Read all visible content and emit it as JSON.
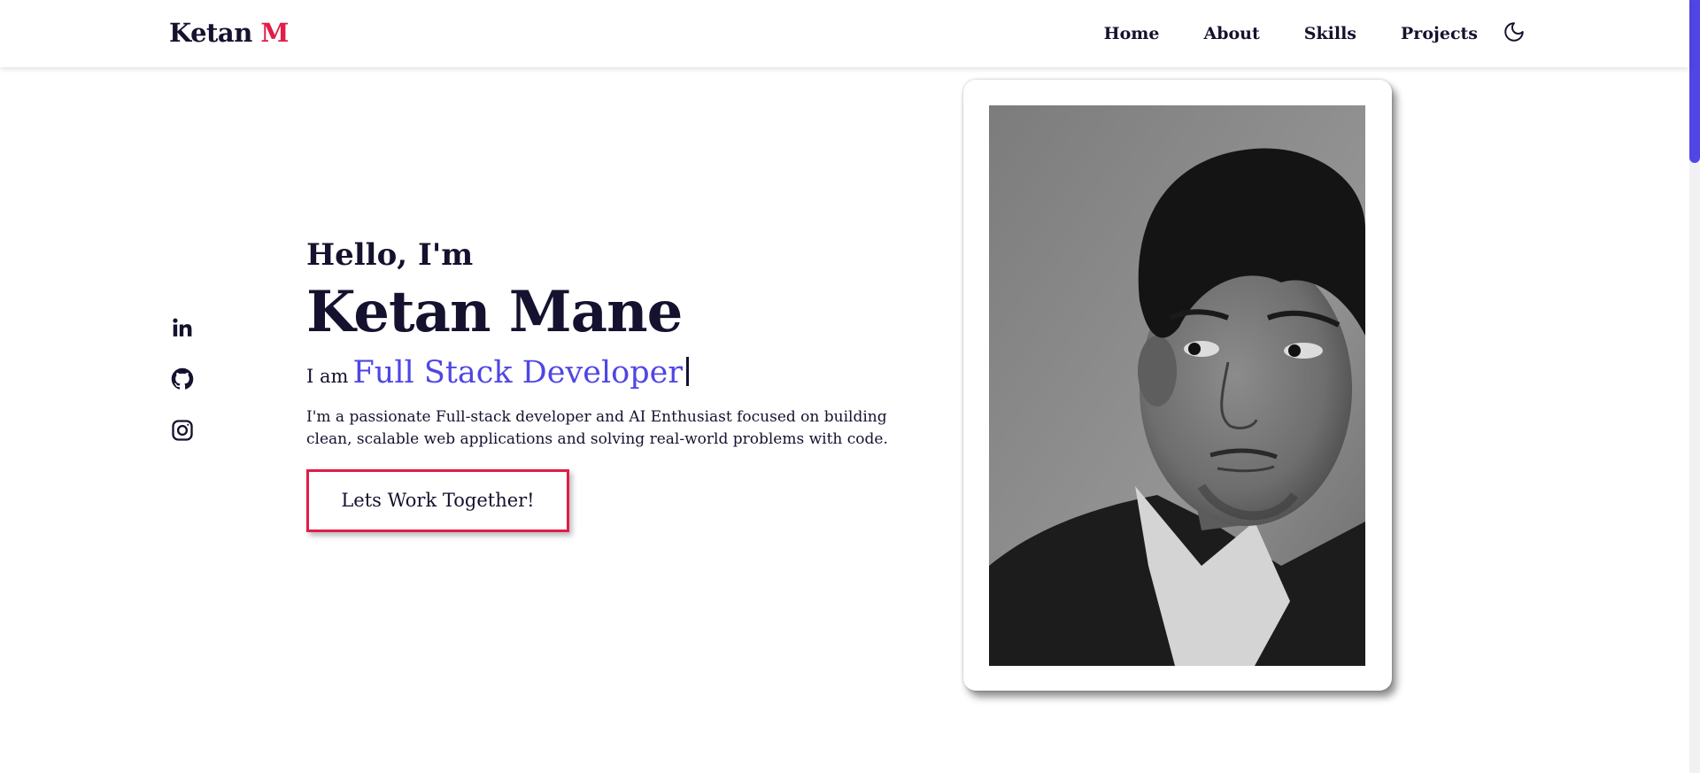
{
  "logo": {
    "first": "Ketan",
    "accent": "M"
  },
  "nav": {
    "links": [
      "Home",
      "About",
      "Skills",
      "Projects"
    ],
    "theme_icon": "moon-icon"
  },
  "socials": [
    {
      "name": "linkedin",
      "icon": "linkedin-icon"
    },
    {
      "name": "github",
      "icon": "github-icon"
    },
    {
      "name": "instagram",
      "icon": "instagram-icon"
    }
  ],
  "hero": {
    "greeting": "Hello, I'm",
    "name": "Ketan Mane",
    "role_prefix": "I am",
    "role": "Full Stack Developer",
    "bio": "I'm a passionate Full-stack developer and AI Enthusiast focused on building clean, scalable web applications and solving real-world problems with code.",
    "cta_label": "Lets Work Together!"
  },
  "colors": {
    "text": "#14122e",
    "accent_red": "#e11d48",
    "accent_indigo": "#4f46e5",
    "background": "#ffffff"
  }
}
